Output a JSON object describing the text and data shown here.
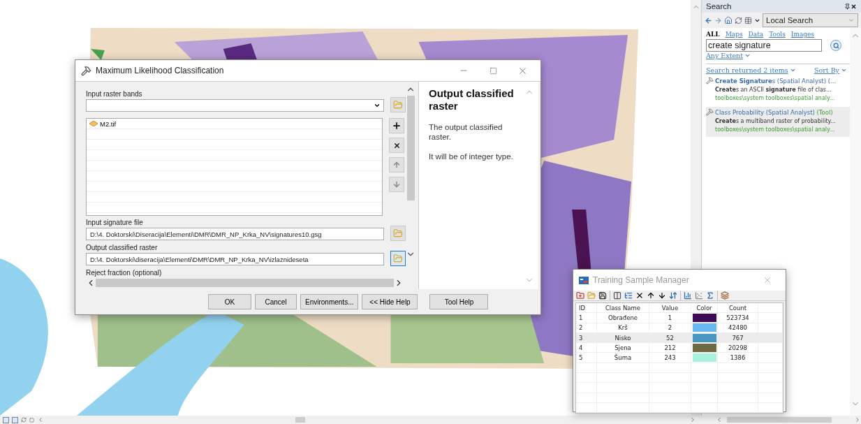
{
  "dialog": {
    "title": "Maximum Likelihood Classification",
    "input_raster_bands": {
      "label": "Input raster bands",
      "items": [
        "M2.tif"
      ]
    },
    "file_fields": [
      {
        "label": "Input signature file",
        "value": "D:\\4. Doktorski\\Diseracija\\Elementi\\DMR\\DMR_NP_Krka_NV\\signatures10.gsg",
        "browse_active": false
      },
      {
        "label": "Output classified raster",
        "value": "D:\\4. Doktorski\\diseracija\\Elementi\\DMR\\DMR_NP_Krka_NV\\izlaznideseta",
        "browse_active": true
      }
    ],
    "cut_label": "Reject fraction (optional)",
    "buttons": [
      "OK",
      "Cancel",
      "Environments...",
      "<< Hide Help",
      "Tool Help"
    ],
    "help": {
      "title": "Output classified raster",
      "paragraphs": [
        "The output classified raster.",
        "It will be of integer type."
      ]
    }
  },
  "search_panel": {
    "title": "Search",
    "scope": "Local Search",
    "filters": [
      {
        "label": "ALL",
        "selected": true
      },
      {
        "label": "Maps",
        "selected": false
      },
      {
        "label": "Data",
        "selected": false
      },
      {
        "label": "Tools",
        "selected": false
      },
      {
        "label": "Images",
        "selected": false
      }
    ],
    "query": "create signature",
    "extent": "Any Extent",
    "summary": "Search returned 2 items",
    "sort": "Sort By",
    "results": [
      {
        "title": "**Create Signature**s (Spatial Analyst) (...",
        "description": "**Create**s an ASCII **signature** file of clas...",
        "path": "toolboxes\\system toolboxes\\spatial analy...",
        "selected": false
      },
      {
        "title": "Class Probability (Spatial Analyst)",
        "tag": "(Tool)",
        "description": "**Create**s a multiband raster of probability...",
        "path": "toolboxes\\system toolboxes\\spatial analy...",
        "selected": true
      }
    ]
  },
  "training_manager": {
    "title": "Training Sample Manager",
    "columns": [
      "ID",
      "Class Name",
      "Value",
      "Color",
      "Count"
    ],
    "rows": [
      {
        "id": "1",
        "class_name": "Obrađene",
        "value": "1",
        "color": "#3d0a5a",
        "count": "523734",
        "selected": false
      },
      {
        "id": "2",
        "class_name": "Krš",
        "value": "2",
        "color": "#6ab8f0",
        "count": "42480",
        "selected": false
      },
      {
        "id": "3",
        "class_name": "Nisko",
        "value": "52",
        "color": "#4a98c0",
        "count": "767",
        "selected": true
      },
      {
        "id": "4",
        "class_name": "Sjena",
        "value": "212",
        "color": "#6e6a45",
        "count": "20298",
        "selected": false
      },
      {
        "id": "5",
        "class_name": "Šuma",
        "value": "243",
        "color": "#a8f0dc",
        "count": "1386",
        "selected": false
      }
    ]
  }
}
